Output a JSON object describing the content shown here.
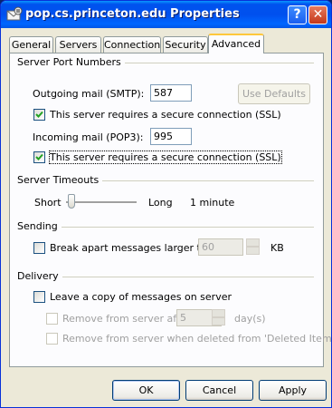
{
  "window": {
    "title": "pop.cs.princeton.edu Properties"
  },
  "tabs": [
    "General",
    "Servers",
    "Connection",
    "Security",
    "Advanced"
  ],
  "ports": {
    "section": "Server Port Numbers",
    "smtp_label": "Outgoing mail (SMTP):",
    "smtp_value": "587",
    "use_defaults": "Use Defaults",
    "smtp_ssl_label": "This server requires a secure connection (SSL)",
    "smtp_ssl_checked": true,
    "pop3_label": "Incoming mail (POP3):",
    "pop3_value": "995",
    "pop3_ssl_label": "This server requires a secure connection (SSL)",
    "pop3_ssl_checked": true
  },
  "timeouts": {
    "section": "Server Timeouts",
    "short_label": "Short",
    "long_label": "Long",
    "value": "1 minute",
    "level": 0.08
  },
  "sending": {
    "section": "Sending",
    "break_label": "Break apart messages larger than",
    "break_value": "60",
    "unit": "KB"
  },
  "delivery": {
    "section": "Delivery",
    "leave_copy_label": "Leave a copy of messages on server",
    "remove_after_label": "Remove from server after",
    "remove_after_value": "5",
    "days_label": "day(s)",
    "remove_deleted_label": "Remove from server when deleted from 'Deleted Items'"
  },
  "buttons": {
    "ok": "OK",
    "cancel": "Cancel",
    "apply": "Apply"
  },
  "colors": {
    "titlebar": "#0054e3",
    "tab_highlight": "#ffc83c",
    "check": "#21a121"
  },
  "icons": {
    "app": "email-server-icon",
    "help": "help-icon",
    "close": "close-icon"
  }
}
